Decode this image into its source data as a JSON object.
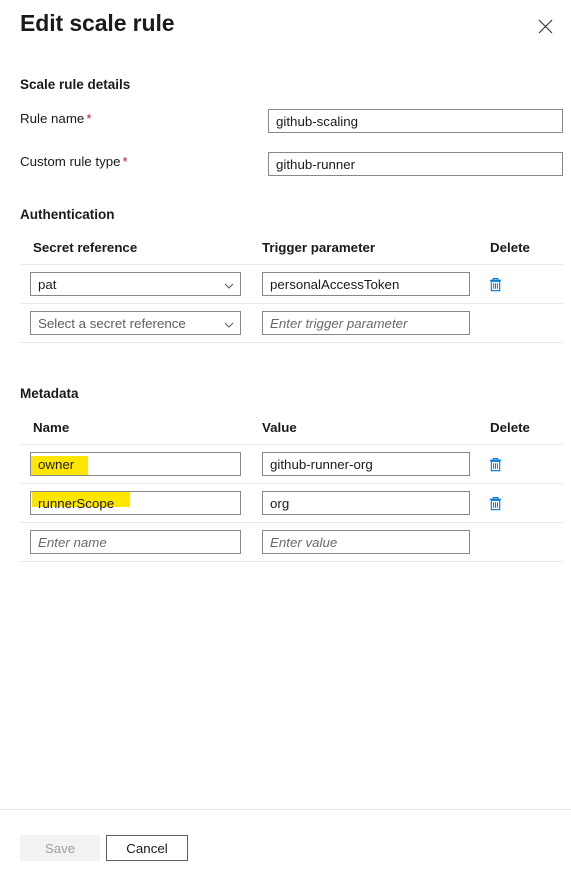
{
  "header": {
    "title": "Edit scale rule",
    "close_icon": "close-icon"
  },
  "scale_rule_details": {
    "heading": "Scale rule details",
    "fields": [
      {
        "label": "Rule name",
        "required": true,
        "value": "github-scaling",
        "placeholder": ""
      },
      {
        "label": "Custom rule type",
        "required": true,
        "value": "github-runner",
        "placeholder": ""
      }
    ]
  },
  "authentication": {
    "heading": "Authentication",
    "columns": {
      "name": "Secret reference",
      "value": "Trigger parameter",
      "delete": "Delete"
    },
    "rows": [
      {
        "secret_reference": "pat",
        "secret_reference_placeholder": "Select a secret reference",
        "trigger_parameter": "personalAccessToken",
        "trigger_parameter_placeholder": "Enter trigger parameter",
        "has_delete": true
      },
      {
        "secret_reference": "",
        "secret_reference_placeholder": "Select a secret reference",
        "trigger_parameter": "",
        "trigger_parameter_placeholder": "Enter trigger parameter",
        "has_delete": false
      }
    ]
  },
  "metadata": {
    "heading": "Metadata",
    "columns": {
      "name": "Name",
      "value": "Value",
      "delete": "Delete"
    },
    "rows": [
      {
        "name": "owner",
        "name_placeholder": "Enter name",
        "value": "github-runner-org",
        "value_placeholder": "Enter value",
        "has_delete": true,
        "highlighted": true
      },
      {
        "name": "runnerScope",
        "name_placeholder": "Enter name",
        "value": "org",
        "value_placeholder": "Enter value",
        "has_delete": true,
        "highlighted": true
      },
      {
        "name": "",
        "name_placeholder": "Enter name",
        "value": "",
        "value_placeholder": "Enter value",
        "has_delete": false,
        "highlighted": false
      }
    ]
  },
  "footer": {
    "save_label": "Save",
    "cancel_label": "Cancel"
  },
  "colors": {
    "accent_link": "#0078d4",
    "required_asterisk": "#a4262c",
    "highlight": "#ffe600",
    "border": "#8a8886",
    "row_divider": "#edebe9",
    "disabled_text": "#a19f9d"
  }
}
